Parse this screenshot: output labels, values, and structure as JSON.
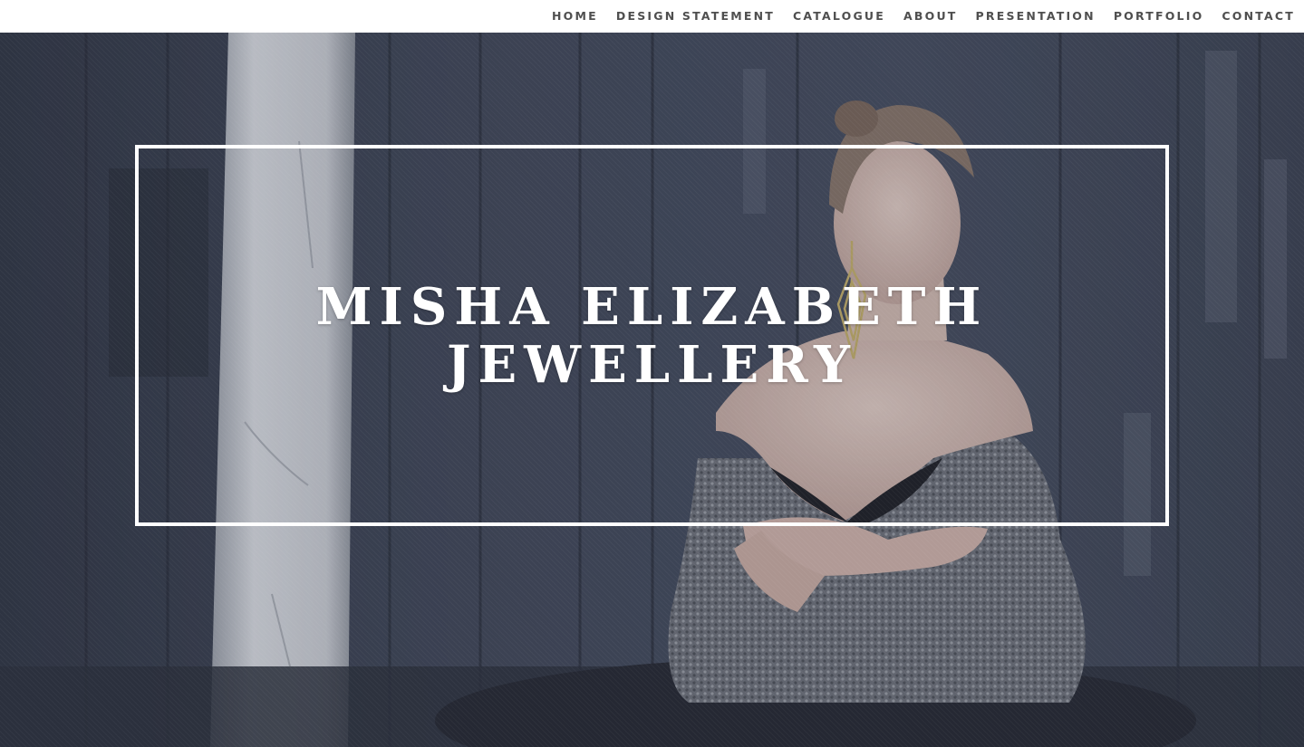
{
  "nav": {
    "items": [
      {
        "label": "HOME"
      },
      {
        "label": "DESIGN STATEMENT"
      },
      {
        "label": "CATALOGUE"
      },
      {
        "label": "ABOUT"
      },
      {
        "label": "PRESENTATION"
      },
      {
        "label": "PORTFOLIO"
      },
      {
        "label": "CONTACT"
      }
    ]
  },
  "hero": {
    "title_line1": "MISHA ELIZABETH",
    "title_line2": "JEWELLERY",
    "image": "model-wearing-geometric-gold-earring-photo"
  },
  "colors": {
    "nav_text": "#4f4f4f",
    "hero_tint": "#3c4352",
    "frame": "#ffffff",
    "title": "#ffffff"
  }
}
